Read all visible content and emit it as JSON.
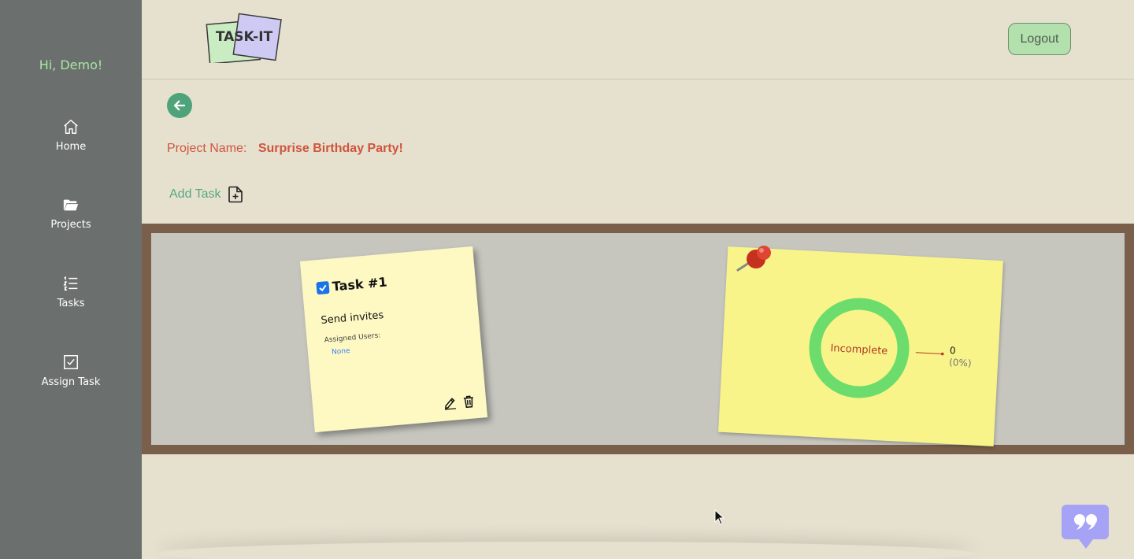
{
  "sidebar": {
    "greeting": "Hi, Demo!",
    "items": [
      {
        "label": "Home",
        "icon": "home-icon"
      },
      {
        "label": "Projects",
        "icon": "folder-open-icon"
      },
      {
        "label": "Tasks",
        "icon": "list-icon"
      },
      {
        "label": "Assign Task",
        "icon": "check-square-icon"
      }
    ]
  },
  "header": {
    "logo_text": "TASK-IT",
    "logout_label": "Logout"
  },
  "project": {
    "name_label": "Project Name:",
    "name_value": "Surprise Birthday Party!",
    "add_task_label": "Add Task"
  },
  "task": {
    "title": "Task #1",
    "description": "Send invites",
    "assigned_label": "Assigned Users:",
    "assigned_value": "None",
    "completed": true
  },
  "chart_data": {
    "type": "pie",
    "series": [
      {
        "name": "Incomplete",
        "values": [
          1
        ]
      }
    ],
    "center_label": "Incomplete",
    "callout_value": "0",
    "callout_percent": "(0%)"
  },
  "colors": {
    "sidebar_bg": "#6b706e",
    "accent_green": "#4fa37a",
    "project_red": "#d0543d",
    "donut_green": "#6cdc6c",
    "feedback_purple": "#a6a2f5"
  }
}
